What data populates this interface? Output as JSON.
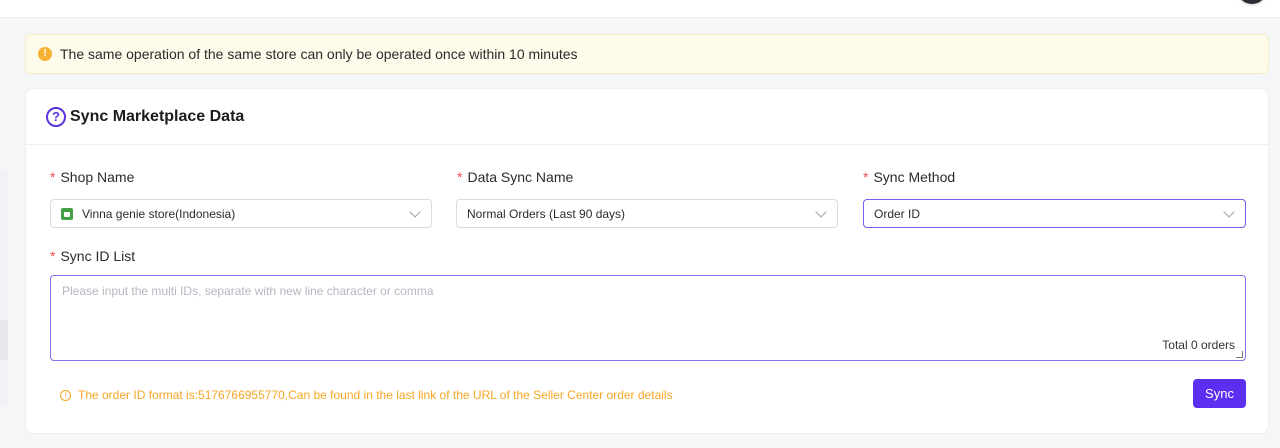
{
  "notice": {
    "text": "The same operation of the same store can only be operated once within 10 minutes",
    "icon": "warning-icon",
    "color": "#f5b233"
  },
  "card": {
    "title": "Sync Marketplace Data",
    "help_icon": "question-circle-icon"
  },
  "form": {
    "required_mark": "*",
    "shop_name": {
      "label": "Shop Name",
      "value": "Vinna genie store(Indonesia)"
    },
    "data_sync_name": {
      "label": "Data Sync Name",
      "value": "Normal Orders (Last 90 days)"
    },
    "sync_method": {
      "label": "Sync Method",
      "value": "Order ID"
    },
    "sync_id_list": {
      "label": "Sync ID List",
      "placeholder": "Please input the multi IDs, separate with new line character or comma",
      "total": "Total 0 orders"
    }
  },
  "hint": {
    "text": "The order ID format is:5176766955770,Can be found in the last link of the URL of the Seller Center order details",
    "color": "#f5a623"
  },
  "actions": {
    "sync_label": "Sync",
    "accent": "#5b2ef0"
  }
}
